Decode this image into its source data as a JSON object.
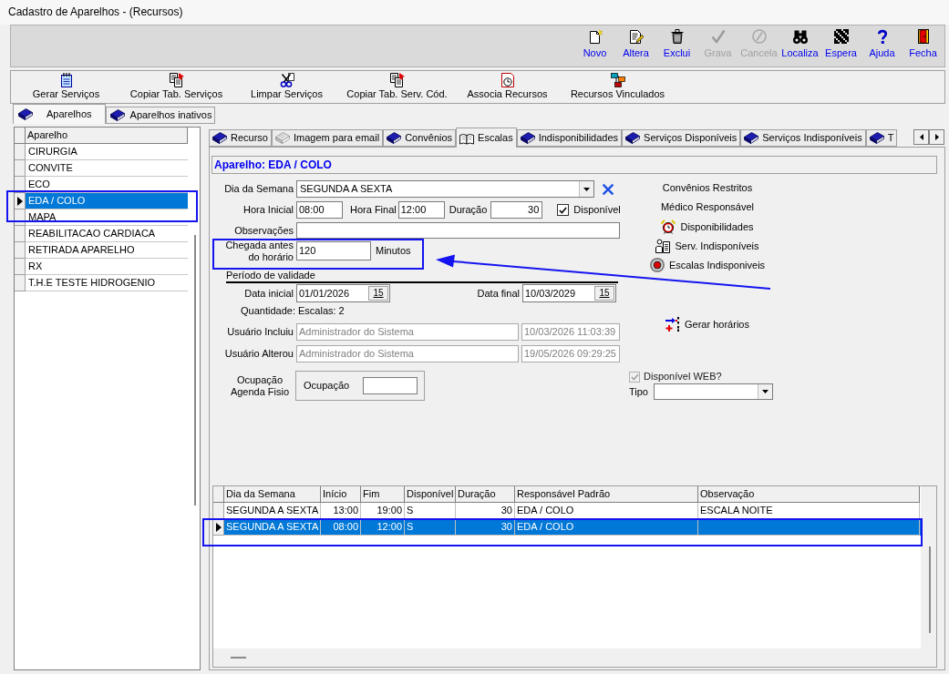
{
  "window": {
    "title": "Cadastro de Aparelhos - (Recursos)"
  },
  "toolbar": [
    {
      "label": "Novo",
      "disabled": false
    },
    {
      "label": "Altera",
      "disabled": false
    },
    {
      "label": "Exclui",
      "disabled": false
    },
    {
      "label": "Grava",
      "disabled": true
    },
    {
      "label": "Cancela",
      "disabled": true
    },
    {
      "label": "Localiza",
      "disabled": false
    },
    {
      "label": "Espera",
      "disabled": false
    },
    {
      "label": "Ajuda",
      "disabled": false
    },
    {
      "label": "Fecha",
      "disabled": false
    }
  ],
  "actions": [
    "Gerar Serviços",
    "Copiar Tab. Serviços",
    "Limpar Serviços",
    "Copiar Tab. Serv. Cód.",
    "Associa Recursos",
    "Recursos Vinculados"
  ],
  "list_tabs": [
    {
      "label": "Aparelhos",
      "selected": true
    },
    {
      "label": "Aparelhos inativos",
      "selected": false
    }
  ],
  "aparelhos": {
    "column": "Aparelho",
    "rows": [
      {
        "name": "CIRURGIA",
        "selected": false,
        "highlighted": false
      },
      {
        "name": "CONVITE",
        "selected": false,
        "highlighted": false
      },
      {
        "name": "ECO",
        "selected": false,
        "highlighted": false
      },
      {
        "name": "EDA / COLO",
        "selected": true,
        "highlighted": true
      },
      {
        "name": "MAPA",
        "selected": false,
        "highlighted": false
      },
      {
        "name": "REABILITACAO CARDIACA",
        "selected": false,
        "highlighted": false
      },
      {
        "name": "RETIRADA APARELHO",
        "selected": false,
        "highlighted": false
      },
      {
        "name": "RX",
        "selected": false,
        "highlighted": false
      },
      {
        "name": "T.H.E  TESTE HIDROGENIO",
        "selected": false,
        "highlighted": false
      }
    ]
  },
  "detail_tabs": [
    {
      "label": "Recurso",
      "selected": false
    },
    {
      "label": "Imagem para email",
      "selected": false
    },
    {
      "label": "Convênios",
      "selected": false
    },
    {
      "label": "Escalas",
      "selected": true
    },
    {
      "label": "Indisponibilidades",
      "selected": false
    },
    {
      "label": "Serviços Disponíveis",
      "selected": false
    },
    {
      "label": "Serviços Indisponíveis",
      "selected": false
    },
    {
      "label": "T",
      "selected": false
    }
  ],
  "detail": {
    "header": "Aparelho: EDA / COLO",
    "dia_da_semana": {
      "label": "Dia da Semana",
      "value": "SEGUNDA A SEXTA"
    },
    "hora_inicial": {
      "label": "Hora Inicial",
      "value": "08:00"
    },
    "hora_final": {
      "label": "Hora Final",
      "value": "12:00"
    },
    "duracao": {
      "label": "Duração",
      "value": "30"
    },
    "disponivel": {
      "label": "Disponível",
      "checked": true
    },
    "observacoes": {
      "label": "Observações"
    },
    "chegada": {
      "label": "Chegada antes do horário",
      "value": "120",
      "unit": "Minutos",
      "highlighted": true,
      "arrow": true
    },
    "periodo": {
      "title": "Período de validade",
      "data_inicial": {
        "label": "Data inicial",
        "value": "01/01/2026",
        "button": "15"
      },
      "data_final": {
        "label": "Data final",
        "value": "10/03/2029",
        "button": "15"
      }
    },
    "quantidade": "Quantidade: Escalas: 2",
    "usuario_incluiu": {
      "label": "Usuário Incluiu",
      "user": "Administrador do Sistema",
      "timestamp": "10/03/2026 11:03:39"
    },
    "usuario_alterou": {
      "label": "Usuário Alterou",
      "user": "Administrador do Sistema",
      "timestamp": "19/05/2026 09:29:25"
    },
    "ocupacao": {
      "group_label": "Ocupação Agenda Fisio",
      "field_label": "Ocupação"
    },
    "side_links": [
      {
        "label": "Convênios Restritos",
        "kind": "text"
      },
      {
        "label": "Médico Responsável",
        "kind": "text"
      },
      {
        "label": "Disponibilidades",
        "kind": "icon"
      },
      {
        "label": "Serv. Indisponíveis",
        "kind": "icon"
      },
      {
        "label": "Escalas Indisponiveis",
        "kind": "icon"
      }
    ],
    "gerar_horarios": "Gerar horários",
    "disponivel_web": {
      "label": "Disponível WEB?",
      "checked": true,
      "disabled": true
    },
    "tipo": {
      "label": "Tipo"
    }
  },
  "schedule": {
    "columns": [
      "Dia da Semana",
      "Início",
      "Fim",
      "Disponível",
      "Duração",
      "Responsável Padrão",
      "Observação"
    ],
    "rows": [
      {
        "dia_da_semana": "SEGUNDA A SEXTA",
        "inicio": "13:00",
        "fim": "19:00",
        "disponivel": "S",
        "duracao": "30",
        "responsavel_padrao": "EDA / COLO",
        "observacao": "ESCALA NOITE",
        "selected": false,
        "highlighted": false
      },
      {
        "dia_da_semana": "SEGUNDA A SEXTA",
        "inicio": "08:00",
        "fim": "12:00",
        "disponivel": "S",
        "duracao": "30",
        "responsavel_padrao": "EDA / COLO",
        "selected": true,
        "highlighted": true
      }
    ]
  }
}
